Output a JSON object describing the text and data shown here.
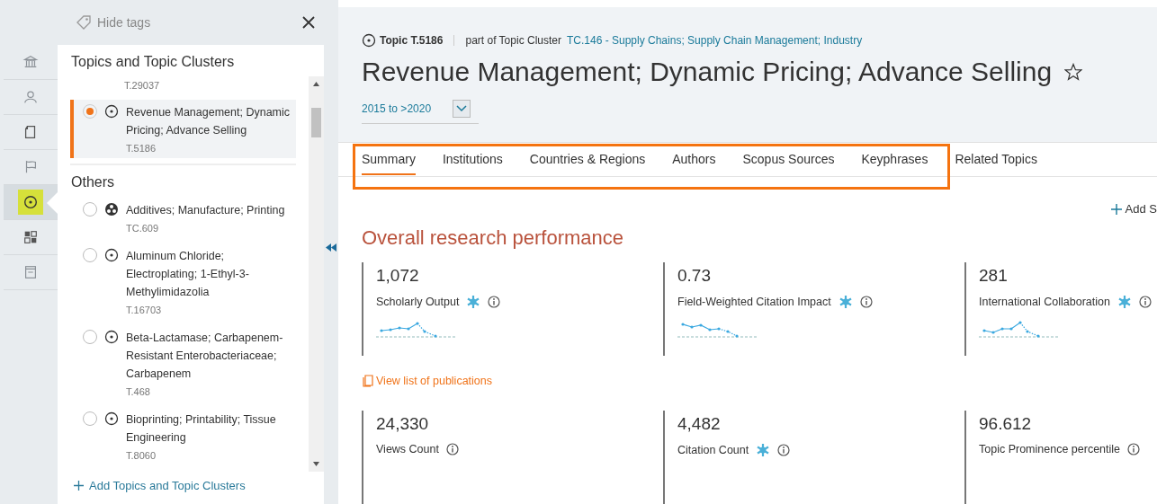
{
  "rail": [
    {
      "selected": false
    },
    {
      "selected": false
    },
    {
      "selected": false
    },
    {
      "selected": false
    },
    {
      "selected": true
    },
    {
      "selected": false
    },
    {
      "selected": false
    }
  ],
  "tags_toggle": "Hide tags",
  "panel": {
    "title": "Topics and Topic Clusters",
    "current": [
      {
        "kind": "plain",
        "code": "T.29037"
      },
      {
        "kind": "topic",
        "name": "Revenue Management; Dynamic Pricing; Advance Selling",
        "code": "T.5186",
        "selected": true
      }
    ],
    "others_title": "Others",
    "others": [
      {
        "kind": "cluster",
        "name": "Additives; Manufacture; Printing",
        "code": "TC.609",
        "selected": false
      },
      {
        "kind": "topic",
        "name": "Aluminum Chloride; Electroplating; 1-Ethyl-3-Methylimidazolia",
        "code": "T.16703",
        "selected": false
      },
      {
        "kind": "topic",
        "name": "Beta-Lactamase; Carbapenem-Resistant Enterobacteriaceae; Carbapenem",
        "code": "T.468",
        "selected": false
      },
      {
        "kind": "topic",
        "name": "Bioprinting; Printability; Tissue Engineering",
        "code": "T.8060",
        "selected": false
      }
    ],
    "add_link": "Add Topics and Topic Clusters"
  },
  "header": {
    "topic_label": "Topic T.5186",
    "part_of": "part of Topic Cluster",
    "cluster_link": "TC.146 - Supply Chains; Supply Chain Management; Industry",
    "title": "Revenue Management; Dynamic Pricing; Advance Selling",
    "starred": false,
    "date_range": "2015 to >2020"
  },
  "tabs": [
    {
      "label": "Summary",
      "selected": true
    },
    {
      "label": "Institutions",
      "selected": false
    },
    {
      "label": "Countries & Regions",
      "selected": false
    },
    {
      "label": "Authors",
      "selected": false
    },
    {
      "label": "Scopus Sources",
      "selected": false
    },
    {
      "label": "Keyphrases",
      "selected": false
    },
    {
      "label": "Related Topics",
      "selected": false
    }
  ],
  "add_action": "Add S",
  "section_title": "Overall research performance",
  "metric_rows": [
    [
      {
        "value": "1,072",
        "label": "Scholarly Output",
        "snowball": true,
        "kind": "trend"
      },
      {
        "value": "0.73",
        "label": "Field-Weighted Citation Impact",
        "snowball": true,
        "kind": "trend"
      },
      {
        "value": "281",
        "label": "International Collaboration",
        "snowball": true,
        "kind": "trend"
      }
    ],
    [
      {
        "value": "24,330",
        "label": "Views Count",
        "snowball": false,
        "kind": "plain"
      },
      {
        "value": "4,482",
        "label": "Citation Count",
        "snowball": true,
        "kind": "plain"
      },
      {
        "value": "96.612",
        "label": "Topic Prominence percentile",
        "snowball": false,
        "kind": "plain"
      }
    ]
  ],
  "publications_link": "View list of publications"
}
